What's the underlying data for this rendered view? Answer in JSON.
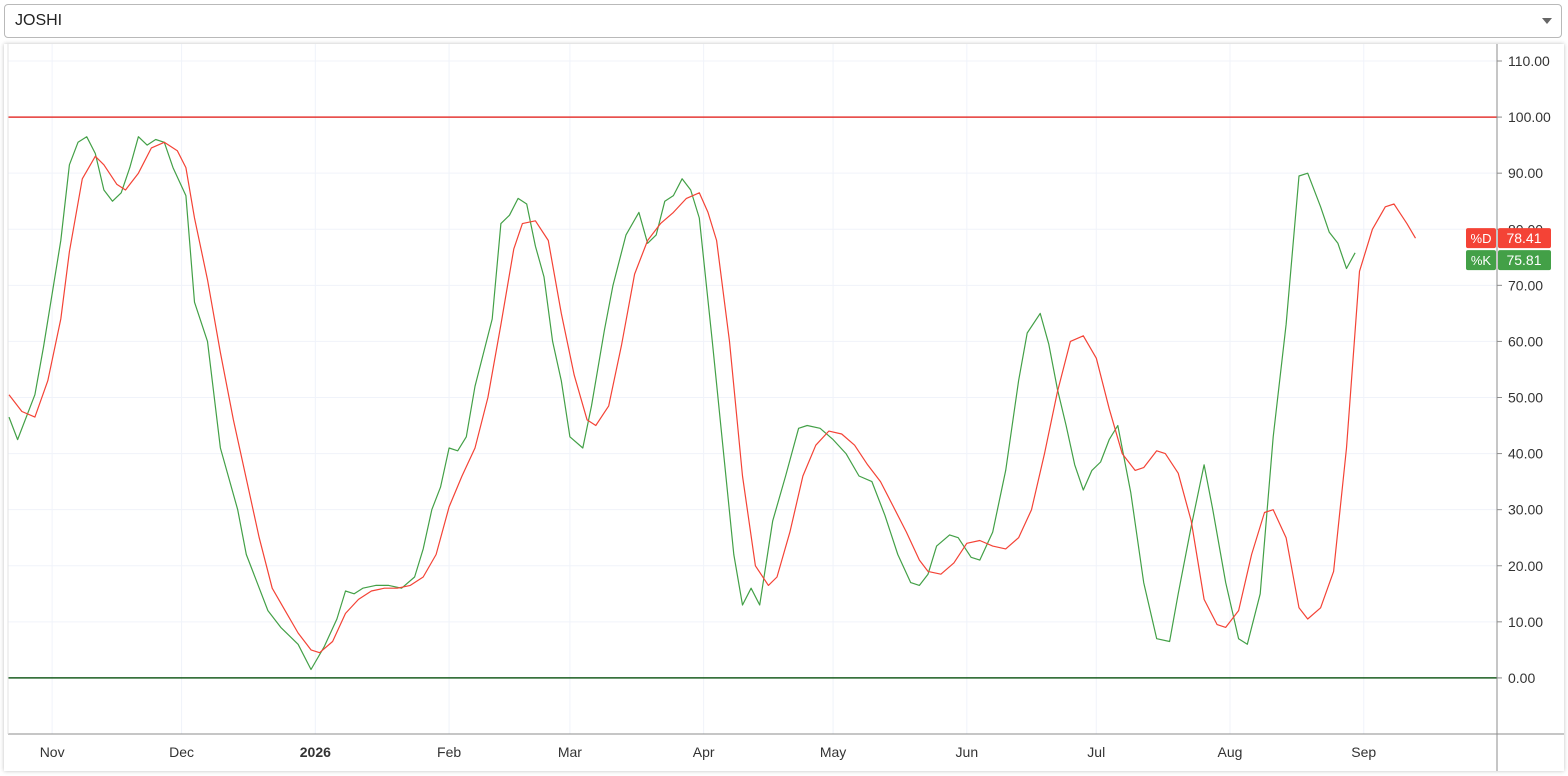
{
  "symbol_selector": {
    "value": "JOSHI"
  },
  "colors": {
    "k_line": "#43a047",
    "d_line": "#f44336",
    "overbought": "#e53935",
    "oversold": "#1b5e20",
    "grid": "#f0f3fa",
    "axis_text": "#333333",
    "border": "#8c8c8c"
  },
  "chart_data": {
    "type": "line",
    "ylim": [
      -10,
      110
    ],
    "yticks": [
      "110.00",
      "100.00",
      "90.00",
      "80.00",
      "70.00",
      "60.00",
      "50.00",
      "40.00",
      "30.00",
      "20.00",
      "10.00",
      "0.00"
    ],
    "x_range": [
      "2025-10-22",
      "2026-09-24"
    ],
    "x_ticks": [
      {
        "label": "Nov",
        "date": "2025-11-01",
        "bold": false
      },
      {
        "label": "Dec",
        "date": "2025-12-01",
        "bold": false
      },
      {
        "label": "2026",
        "date": "2026-01-01",
        "bold": true
      },
      {
        "label": "Feb",
        "date": "2026-02-01",
        "bold": false
      },
      {
        "label": "Mar",
        "date": "2026-03-01",
        "bold": false
      },
      {
        "label": "Apr",
        "date": "2026-04-01",
        "bold": false
      },
      {
        "label": "May",
        "date": "2026-05-01",
        "bold": false
      },
      {
        "label": "Jun",
        "date": "2026-06-01",
        "bold": false
      },
      {
        "label": "Jul",
        "date": "2026-07-01",
        "bold": false
      },
      {
        "label": "Aug",
        "date": "2026-08-01",
        "bold": false
      },
      {
        "label": "Sep",
        "date": "2026-09-01",
        "bold": false
      }
    ],
    "hlines": [
      {
        "value": 100,
        "color_key": "overbought"
      },
      {
        "value": 0,
        "color_key": "oversold"
      }
    ],
    "series": [
      {
        "name": "%K",
        "last_label": "75.81",
        "color_key": "k_line",
        "points": [
          [
            "2025-10-22",
            46.5
          ],
          [
            "2025-10-24",
            42.5
          ],
          [
            "2025-10-28",
            50.5
          ],
          [
            "2025-10-30",
            59.0
          ],
          [
            "2025-11-03",
            78.0
          ],
          [
            "2025-11-05",
            91.5
          ],
          [
            "2025-11-07",
            95.5
          ],
          [
            "2025-11-09",
            96.5
          ],
          [
            "2025-11-11",
            93.5
          ],
          [
            "2025-11-13",
            87.0
          ],
          [
            "2025-11-15",
            85.0
          ],
          [
            "2025-11-17",
            86.5
          ],
          [
            "2025-11-19",
            91.0
          ],
          [
            "2025-11-21",
            96.5
          ],
          [
            "2025-11-23",
            95.0
          ],
          [
            "2025-11-25",
            96.0
          ],
          [
            "2025-11-27",
            95.5
          ],
          [
            "2025-11-29",
            91.0
          ],
          [
            "2025-12-02",
            86.0
          ],
          [
            "2025-12-04",
            67.0
          ],
          [
            "2025-12-07",
            60.0
          ],
          [
            "2025-12-10",
            41.0
          ],
          [
            "2025-12-14",
            30.0
          ],
          [
            "2025-12-16",
            22.0
          ],
          [
            "2025-12-21",
            12.0
          ],
          [
            "2025-12-24",
            9.0
          ],
          [
            "2025-12-28",
            6.0
          ],
          [
            "2025-12-31",
            1.5
          ],
          [
            "2026-01-03",
            5.5
          ],
          [
            "2026-01-06",
            10.5
          ],
          [
            "2026-01-08",
            15.5
          ],
          [
            "2026-01-10",
            15.0
          ],
          [
            "2026-01-12",
            16.0
          ],
          [
            "2026-01-15",
            16.5
          ],
          [
            "2026-01-18",
            16.5
          ],
          [
            "2026-01-21",
            16.0
          ],
          [
            "2026-01-24",
            18.0
          ],
          [
            "2026-01-26",
            23.0
          ],
          [
            "2026-01-28",
            30.0
          ],
          [
            "2026-01-30",
            34.0
          ],
          [
            "2026-02-01",
            41.0
          ],
          [
            "2026-02-03",
            40.5
          ],
          [
            "2026-02-05",
            43.0
          ],
          [
            "2026-02-07",
            52.0
          ],
          [
            "2026-02-11",
            64.0
          ],
          [
            "2026-02-13",
            81.0
          ],
          [
            "2026-02-15",
            82.5
          ],
          [
            "2026-02-17",
            85.5
          ],
          [
            "2026-02-19",
            84.5
          ],
          [
            "2026-02-21",
            77.0
          ],
          [
            "2026-02-23",
            71.5
          ],
          [
            "2026-02-25",
            60.0
          ],
          [
            "2026-02-27",
            53.0
          ],
          [
            "2026-03-01",
            43.0
          ],
          [
            "2026-03-04",
            41.0
          ],
          [
            "2026-03-06",
            48.5
          ],
          [
            "2026-03-09",
            62.0
          ],
          [
            "2026-03-11",
            70.0
          ],
          [
            "2026-03-14",
            79.0
          ],
          [
            "2026-03-17",
            83.0
          ],
          [
            "2026-03-19",
            77.5
          ],
          [
            "2026-03-21",
            79.0
          ],
          [
            "2026-03-23",
            85.0
          ],
          [
            "2026-03-25",
            86.0
          ],
          [
            "2026-03-27",
            89.0
          ],
          [
            "2026-03-29",
            87.0
          ],
          [
            "2026-03-31",
            82.0
          ],
          [
            "2026-04-03",
            60.0
          ],
          [
            "2026-04-08",
            22.0
          ],
          [
            "2026-04-10",
            13.0
          ],
          [
            "2026-04-12",
            16.0
          ],
          [
            "2026-04-14",
            13.0
          ],
          [
            "2026-04-17",
            28.0
          ],
          [
            "2026-04-20",
            36.0
          ],
          [
            "2026-04-23",
            44.5
          ],
          [
            "2026-04-25",
            45.0
          ],
          [
            "2026-04-28",
            44.5
          ],
          [
            "2026-05-01",
            42.5
          ],
          [
            "2026-05-04",
            40.0
          ],
          [
            "2026-05-07",
            36.0
          ],
          [
            "2026-05-10",
            35.0
          ],
          [
            "2026-05-13",
            29.0
          ],
          [
            "2026-05-16",
            22.0
          ],
          [
            "2026-05-19",
            17.0
          ],
          [
            "2026-05-21",
            16.5
          ],
          [
            "2026-05-23",
            18.5
          ],
          [
            "2026-05-25",
            23.5
          ],
          [
            "2026-05-28",
            25.5
          ],
          [
            "2026-05-30",
            25.0
          ],
          [
            "2026-06-02",
            21.5
          ],
          [
            "2026-06-04",
            21.0
          ],
          [
            "2026-06-07",
            26.0
          ],
          [
            "2026-06-10",
            37.0
          ],
          [
            "2026-06-13",
            53.0
          ],
          [
            "2026-06-15",
            61.5
          ],
          [
            "2026-06-18",
            65.0
          ],
          [
            "2026-06-20",
            59.5
          ],
          [
            "2026-06-22",
            51.5
          ],
          [
            "2026-06-24",
            45.0
          ],
          [
            "2026-06-26",
            38.0
          ],
          [
            "2026-06-28",
            33.5
          ],
          [
            "2026-06-30",
            37.0
          ],
          [
            "2026-07-02",
            38.5
          ],
          [
            "2026-07-04",
            42.5
          ],
          [
            "2026-07-06",
            45.0
          ],
          [
            "2026-07-09",
            33.0
          ],
          [
            "2026-07-12",
            17.0
          ],
          [
            "2026-07-15",
            7.0
          ],
          [
            "2026-07-18",
            6.5
          ],
          [
            "2026-07-20",
            15.0
          ],
          [
            "2026-07-23",
            27.0
          ],
          [
            "2026-07-26",
            38.0
          ],
          [
            "2026-07-28",
            30.0
          ],
          [
            "2026-07-31",
            17.0
          ],
          [
            "2026-08-03",
            7.0
          ],
          [
            "2026-08-05",
            6.0
          ],
          [
            "2026-08-08",
            15.0
          ],
          [
            "2026-08-11",
            43.0
          ],
          [
            "2026-08-14",
            63.0
          ],
          [
            "2026-08-17",
            89.5
          ],
          [
            "2026-08-19",
            90.0
          ],
          [
            "2026-08-22",
            84.0
          ],
          [
            "2026-08-24",
            79.5
          ],
          [
            "2026-08-26",
            77.5
          ],
          [
            "2026-08-28",
            73.0
          ],
          [
            "2026-08-30",
            75.8
          ]
        ]
      },
      {
        "name": "%D",
        "last_label": "78.41",
        "color_key": "d_line",
        "points": [
          [
            "2025-10-22",
            50.5
          ],
          [
            "2025-10-25",
            47.5
          ],
          [
            "2025-10-28",
            46.5
          ],
          [
            "2025-10-31",
            53.0
          ],
          [
            "2025-11-03",
            64.0
          ],
          [
            "2025-11-05",
            76.0
          ],
          [
            "2025-11-08",
            89.0
          ],
          [
            "2025-11-11",
            93.0
          ],
          [
            "2025-11-13",
            91.5
          ],
          [
            "2025-11-16",
            88.0
          ],
          [
            "2025-11-18",
            87.0
          ],
          [
            "2025-11-21",
            90.0
          ],
          [
            "2025-11-24",
            94.5
          ],
          [
            "2025-11-27",
            95.5
          ],
          [
            "2025-11-30",
            94.0
          ],
          [
            "2025-12-02",
            91.0
          ],
          [
            "2025-12-04",
            82.0
          ],
          [
            "2025-12-07",
            71.0
          ],
          [
            "2025-12-10",
            58.0
          ],
          [
            "2025-12-13",
            46.0
          ],
          [
            "2025-12-16",
            35.5
          ],
          [
            "2025-12-19",
            25.0
          ],
          [
            "2025-12-22",
            16.0
          ],
          [
            "2025-12-25",
            12.0
          ],
          [
            "2025-12-28",
            8.0
          ],
          [
            "2025-12-31",
            5.0
          ],
          [
            "2026-01-02",
            4.5
          ],
          [
            "2026-01-05",
            6.5
          ],
          [
            "2026-01-08",
            11.5
          ],
          [
            "2026-01-11",
            14.0
          ],
          [
            "2026-01-14",
            15.5
          ],
          [
            "2026-01-17",
            16.0
          ],
          [
            "2026-01-20",
            16.0
          ],
          [
            "2026-01-23",
            16.5
          ],
          [
            "2026-01-26",
            18.0
          ],
          [
            "2026-01-29",
            22.0
          ],
          [
            "2026-02-01",
            30.5
          ],
          [
            "2026-02-04",
            36.0
          ],
          [
            "2026-02-07",
            41.0
          ],
          [
            "2026-02-10",
            50.0
          ],
          [
            "2026-02-13",
            63.0
          ],
          [
            "2026-02-16",
            76.5
          ],
          [
            "2026-02-18",
            81.0
          ],
          [
            "2026-02-21",
            81.5
          ],
          [
            "2026-02-24",
            78.0
          ],
          [
            "2026-02-27",
            65.0
          ],
          [
            "2026-03-02",
            54.0
          ],
          [
            "2026-03-05",
            46.0
          ],
          [
            "2026-03-07",
            45.0
          ],
          [
            "2026-03-10",
            48.5
          ],
          [
            "2026-03-13",
            59.5
          ],
          [
            "2026-03-16",
            72.0
          ],
          [
            "2026-03-19",
            78.0
          ],
          [
            "2026-03-22",
            81.0
          ],
          [
            "2026-03-25",
            83.0
          ],
          [
            "2026-03-28",
            85.5
          ],
          [
            "2026-03-31",
            86.5
          ],
          [
            "2026-04-02",
            83.0
          ],
          [
            "2026-04-04",
            78.0
          ],
          [
            "2026-04-07",
            60.0
          ],
          [
            "2026-04-10",
            36.0
          ],
          [
            "2026-04-13",
            20.0
          ],
          [
            "2026-04-16",
            16.5
          ],
          [
            "2026-04-18",
            18.0
          ],
          [
            "2026-04-21",
            26.0
          ],
          [
            "2026-04-24",
            36.0
          ],
          [
            "2026-04-27",
            41.5
          ],
          [
            "2026-04-30",
            44.0
          ],
          [
            "2026-05-03",
            43.5
          ],
          [
            "2026-05-06",
            41.5
          ],
          [
            "2026-05-09",
            38.0
          ],
          [
            "2026-05-12",
            35.0
          ],
          [
            "2026-05-15",
            30.5
          ],
          [
            "2026-05-18",
            26.0
          ],
          [
            "2026-05-21",
            21.0
          ],
          [
            "2026-05-23",
            19.0
          ],
          [
            "2026-05-26",
            18.5
          ],
          [
            "2026-05-29",
            20.5
          ],
          [
            "2026-06-01",
            24.0
          ],
          [
            "2026-06-04",
            24.5
          ],
          [
            "2026-06-07",
            23.5
          ],
          [
            "2026-06-10",
            23.0
          ],
          [
            "2026-06-13",
            25.0
          ],
          [
            "2026-06-16",
            30.0
          ],
          [
            "2026-06-19",
            40.0
          ],
          [
            "2026-06-22",
            51.0
          ],
          [
            "2026-06-25",
            60.0
          ],
          [
            "2026-06-28",
            61.0
          ],
          [
            "2026-07-01",
            57.0
          ],
          [
            "2026-07-04",
            48.0
          ],
          [
            "2026-07-07",
            40.0
          ],
          [
            "2026-07-10",
            37.0
          ],
          [
            "2026-07-12",
            37.5
          ],
          [
            "2026-07-15",
            40.5
          ],
          [
            "2026-07-17",
            40.0
          ],
          [
            "2026-07-20",
            36.5
          ],
          [
            "2026-07-23",
            28.0
          ],
          [
            "2026-07-26",
            14.0
          ],
          [
            "2026-07-29",
            9.5
          ],
          [
            "2026-07-31",
            9.0
          ],
          [
            "2026-08-03",
            12.0
          ],
          [
            "2026-08-06",
            22.0
          ],
          [
            "2026-08-09",
            29.5
          ],
          [
            "2026-08-11",
            30.0
          ],
          [
            "2026-08-14",
            25.0
          ],
          [
            "2026-08-17",
            12.5
          ],
          [
            "2026-08-19",
            10.5
          ],
          [
            "2026-08-22",
            12.5
          ],
          [
            "2026-08-25",
            19.0
          ],
          [
            "2026-08-28",
            41.0
          ],
          [
            "2026-08-31",
            72.5
          ],
          [
            "2026-09-03",
            80.0
          ],
          [
            "2026-09-06",
            84.0
          ],
          [
            "2026-09-08",
            84.5
          ],
          [
            "2026-09-11",
            81.0
          ],
          [
            "2026-09-13",
            78.4
          ]
        ]
      }
    ]
  }
}
